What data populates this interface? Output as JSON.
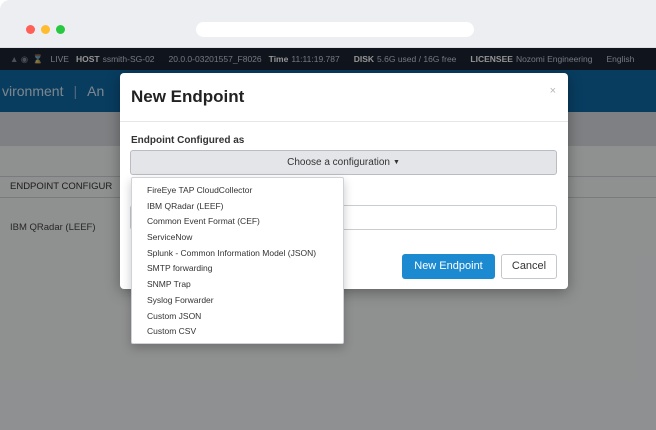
{
  "status_bar": {
    "live": "LIVE",
    "host_label": "HOST",
    "host": "ssmith-SG-02",
    "version": "20.0.0-03201557_F8026",
    "time_label": "Time",
    "time": "11:11:19.787",
    "disk_label": "DISK",
    "disk": "5.6G used / 16G free",
    "licensee_label": "LICENSEE",
    "licensee": "Nozomi Engineering",
    "language": "English"
  },
  "app_header": {
    "breadcrumb_1": "vironment",
    "breadcrumb_2": "An"
  },
  "background_table": {
    "header": "ENDPOINT CONFIGUR",
    "row_1": "IBM QRadar (LEEF)"
  },
  "modal": {
    "title": "New Endpoint",
    "close": "×",
    "field_label": "Endpoint Configured as",
    "select_placeholder": "Choose a configuration",
    "submit_label": "New Endpoint",
    "cancel_label": "Cancel"
  },
  "dropdown": {
    "options": [
      "FireEye TAP CloudCollector",
      "IBM QRadar (LEEF)",
      "Common Event Format (CEF)",
      "ServiceNow",
      "Splunk - Common Information Model (JSON)",
      "SMTP forwarding",
      "SNMP Trap",
      "Syslog Forwarder",
      "Custom JSON",
      "Custom CSV"
    ]
  },
  "colors": {
    "header_blue": "#0e6aa6",
    "primary_button": "#1c8ad1",
    "status_bar": "#1c2433"
  }
}
